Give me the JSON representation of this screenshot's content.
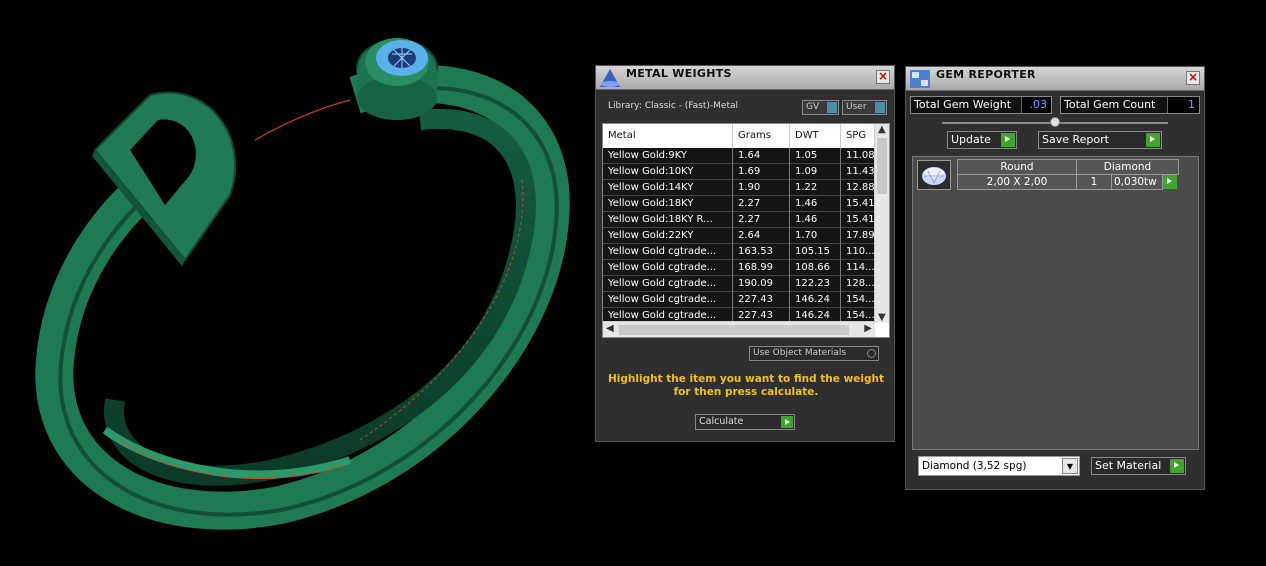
{
  "metal_weights": {
    "title": "METAL WEIGHTS",
    "library_label": "Library: Classic - (Fast)-Metal",
    "toggle_gv": "GV",
    "toggle_user": "User",
    "columns": [
      "Metal",
      "Grams",
      "DWT",
      "SPG"
    ],
    "rows": [
      [
        "Yellow Gold:9KY",
        "1.64",
        "1.05",
        "11.08"
      ],
      [
        "Yellow Gold:10KY",
        "1.69",
        "1.09",
        "11.43"
      ],
      [
        "Yellow Gold:14KY",
        "1.90",
        "1.22",
        "12.88"
      ],
      [
        "Yellow Gold:18KY",
        "2.27",
        "1.46",
        "15.41"
      ],
      [
        "Yellow Gold:18KY R...",
        "2.27",
        "1.46",
        "15.41"
      ],
      [
        "Yellow Gold:22KY",
        "2.64",
        "1.70",
        "17.89"
      ],
      [
        "Yellow Gold cgtrade...",
        "163.53",
        "105.15",
        "110..."
      ],
      [
        "Yellow Gold cgtrade...",
        "168.99",
        "108.66",
        "114..."
      ],
      [
        "Yellow Gold cgtrade...",
        "190.09",
        "122.23",
        "128..."
      ],
      [
        "Yellow Gold cgtrade...",
        "227.43",
        "146.24",
        "154..."
      ],
      [
        "Yellow Gold cgtrade...",
        "227.43",
        "146.24",
        "154..."
      ]
    ],
    "use_object_materials": "Use Object Materials",
    "hint_line1": "Highlight the item you want to find the weight",
    "hint_line2": "for then press calculate.",
    "calculate_label": "Calculate"
  },
  "gem_reporter": {
    "title": "GEM REPORTER",
    "total_gem_weight_label": "Total Gem Weight",
    "total_gem_weight_value": ".03",
    "total_gem_count_label": "Total Gem Count",
    "total_gem_count_value": "1",
    "update_label": "Update",
    "save_report_label": "Save Report",
    "gem_row": {
      "shape": "Round",
      "material": "Diamond",
      "size": "2,00 X 2,00",
      "count": "1",
      "weight": "0,030tw"
    },
    "material_select": "Diamond    (3,52 spg)",
    "set_material_label": "Set Material"
  },
  "colors": {
    "ring_green": "#1f7a55",
    "hint_yellow": "#f0c020",
    "play_green": "#3fa52c"
  }
}
